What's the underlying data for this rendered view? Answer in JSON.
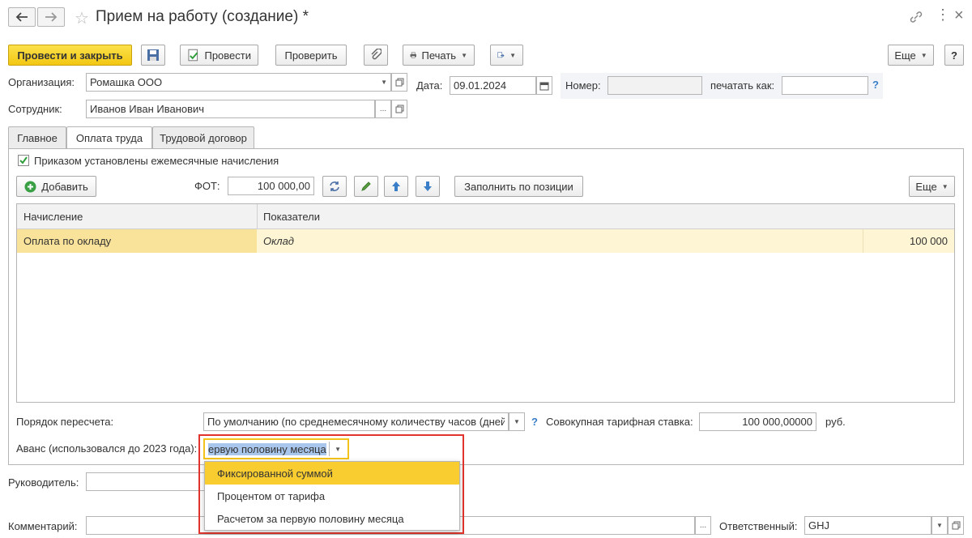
{
  "window": {
    "title": "Прием на работу (создание) *"
  },
  "toolbar": {
    "post_close_label": "Провести и закрыть",
    "post_label": "Провести",
    "check_label": "Проверить",
    "print_label": "Печать",
    "more_label": "Еще"
  },
  "header": {
    "org_label": "Организация:",
    "org_value": "Ромашка ООО",
    "date_label": "Дата:",
    "date_value": "09.01.2024",
    "number_label": "Номер:",
    "number_value": "",
    "print_as_label": "печатать как:",
    "print_as_value": "",
    "help_label": "?",
    "employee_label": "Сотрудник:",
    "employee_value": "Иванов Иван Иванович",
    "ellipsis": "..."
  },
  "tabs": [
    {
      "label": "Главное",
      "active": false
    },
    {
      "label": "Оплата труда",
      "active": true
    },
    {
      "label": "Трудовой договор",
      "active": false
    }
  ],
  "payroll": {
    "checkbox_label": "Приказом установлены ежемесячные начисления",
    "checkbox_checked": true,
    "add_label": "Добавить",
    "fot_label": "ФОТ:",
    "fot_value": "100 000,00",
    "fill_label": "Заполнить по позиции",
    "more_label": "Еще",
    "table": {
      "columns": [
        "Начисление",
        "Показатели"
      ],
      "rows": [
        {
          "accrual": "Оплата по окладу",
          "indicator": "Оклад",
          "value": "100 000"
        }
      ]
    },
    "recalc_label": "Порядок пересчета:",
    "recalc_value": "По умолчанию (по среднемесячному количеству часов (дней)",
    "rate_label": "Совокупная тарифная ставка:",
    "rate_value": "100 000,00000",
    "rate_unit": "руб.",
    "advance_label": "Аванс (использовался до 2023 года):",
    "advance_value": "ервую половину месяца",
    "advance_options": [
      "Фиксированной суммой",
      "Процентом от тарифа",
      "Расчетом за первую половину месяца"
    ],
    "advance_highlighted_index": 0
  },
  "footer": {
    "manager_label": "Руководитель:",
    "manager_value": "",
    "comment_label": "Комментарий:",
    "comment_value": "",
    "responsible_label": "Ответственный:",
    "responsible_value": "GHJ"
  },
  "colors": {
    "primary_button": "#f5cc1c",
    "selected_row": "#fdf5d4",
    "highlight_option": "#f9cd30",
    "callout_border": "#e0342c",
    "help_blue": "#3a7ec8"
  }
}
